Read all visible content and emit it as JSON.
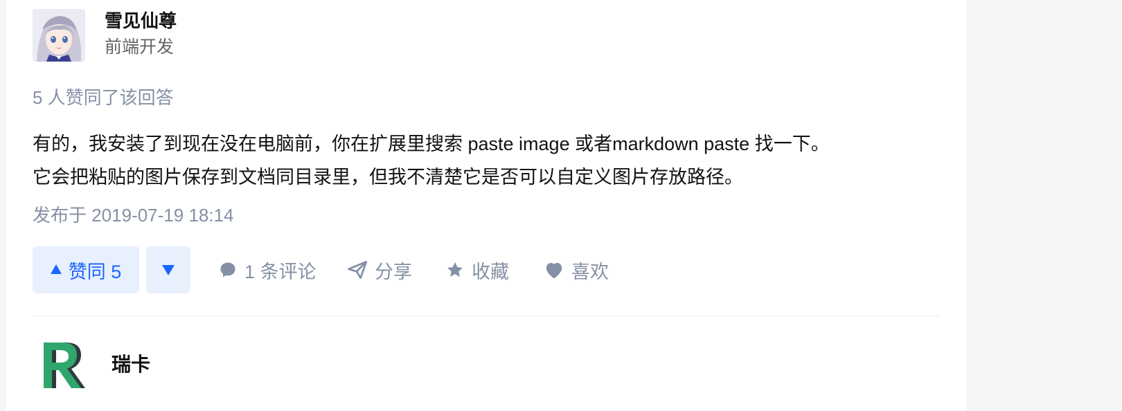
{
  "answer": {
    "author": {
      "name": "雪见仙尊",
      "headline": "前端开发",
      "avatar_icon": "anime-avatar"
    },
    "voters_text": "5 人赞同了该回答",
    "content": [
      "有的，我安装了到现在没在电脑前，你在扩展里搜索 paste image 或者markdown paste 找一下。",
      "它会把粘贴的图片保存到文档同目录里，但我不清楚它是否可以自定义图片存放路径。"
    ],
    "published": "发布于 2019-07-19 18:14",
    "actions": {
      "vote_up": "赞同 5",
      "comment": "1 条评论",
      "share": "分享",
      "favorite": "收藏",
      "like": "喜欢"
    }
  },
  "next_answer": {
    "author": {
      "name": "瑞卡",
      "avatar_icon": "r-letter-logo"
    }
  },
  "colors": {
    "accent": "#1a66ff",
    "vote_bg": "#e8f0fe",
    "muted": "#8590a6",
    "text": "#121212",
    "logo_green": "#2fa66b",
    "logo_dark": "#2e3b3e"
  }
}
